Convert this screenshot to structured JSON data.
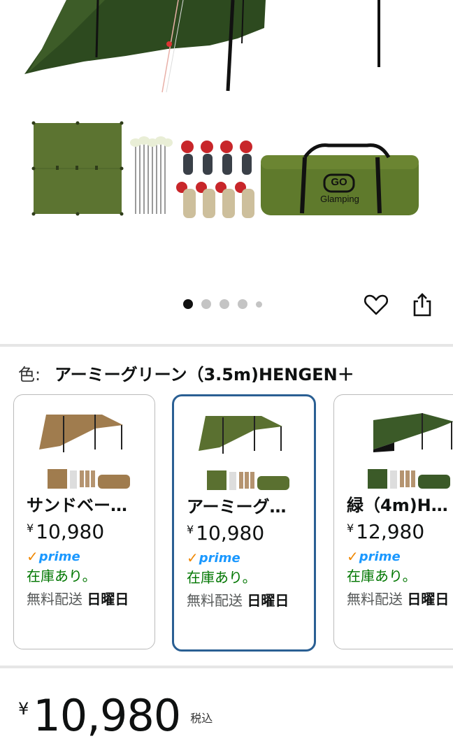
{
  "gallery": {
    "bag_brand_line1": "GO",
    "bag_brand_line2": "Glamping",
    "dots_count": 5,
    "active_index": 0
  },
  "color_selector": {
    "label": "色:",
    "selected_value": "アーミーグリーン（3.5m)HENGEN＋"
  },
  "variants": [
    {
      "title": "サンドベー…",
      "price_symbol": "¥",
      "price": "10,980",
      "prime": "prime",
      "stock": "在庫あり。",
      "shipping_prefix": "無料配送",
      "shipping_day": "日曜日",
      "tarp_color": "#a07c4e",
      "selected": false
    },
    {
      "title": "アーミーグ…",
      "price_symbol": "¥",
      "price": "10,980",
      "prime": "prime",
      "stock": "在庫あり。",
      "shipping_prefix": "無料配送",
      "shipping_day": "日曜日",
      "tarp_color": "#5a7030",
      "selected": true
    },
    {
      "title": "緑（4m)H…",
      "price_symbol": "¥",
      "price": "12,980",
      "prime": "prime",
      "stock": "在庫あり。",
      "shipping_prefix": "無料配送",
      "shipping_day": "日曜日",
      "tarp_color": "#3b5a28",
      "selected": false
    }
  ],
  "price": {
    "symbol": "¥",
    "amount": "10,980",
    "tax_note": "税込"
  },
  "colors": {
    "tarp_green": "#556b2f",
    "tarp_dark": "#2e4a1e",
    "selected_border": "#2a5f93",
    "stock_green": "#007600",
    "prime_blue": "#1a98ff",
    "prime_check": "#f08804"
  },
  "icons": {
    "wishlist": "heart-icon",
    "share": "share-icon"
  }
}
